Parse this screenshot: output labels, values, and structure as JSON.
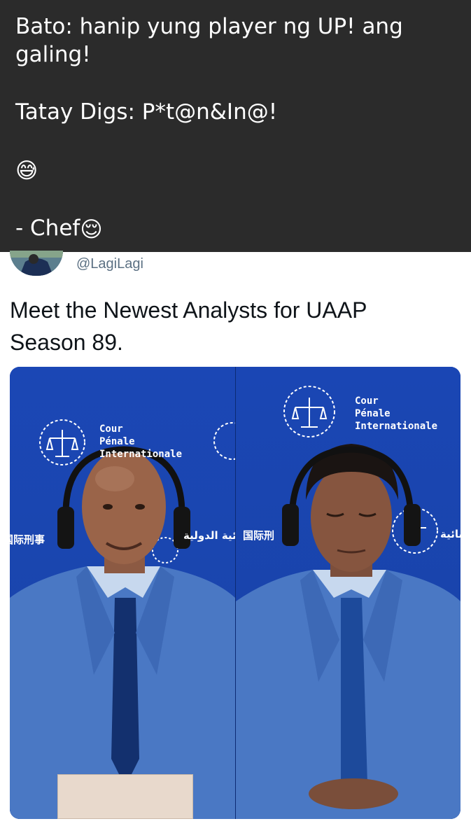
{
  "post": {
    "line1": "Bato: hanip yung player ng UP! ang",
    "line2": "galing!",
    "line3": "Tatay Digs: P*t@n&In@!",
    "emoji1": "😅",
    "signature": "- Chef",
    "emoji2": "😌"
  },
  "tweet": {
    "handle": "@LagiLagi",
    "text_line1": "Meet the Newest Analysts for UAAP",
    "text_line2": "Season 89."
  },
  "media": {
    "left": {
      "logo_text": [
        "Cour",
        "Pénale",
        "Internationale"
      ],
      "chinese_text": "国际刑事",
      "arabic_text": "الجنائية الدولية"
    },
    "right": {
      "logo_text": [
        "Cour",
        "Pénale",
        "Internationale"
      ],
      "chinese_text": "国际刑",
      "arabic_text": "الجنائية"
    }
  }
}
